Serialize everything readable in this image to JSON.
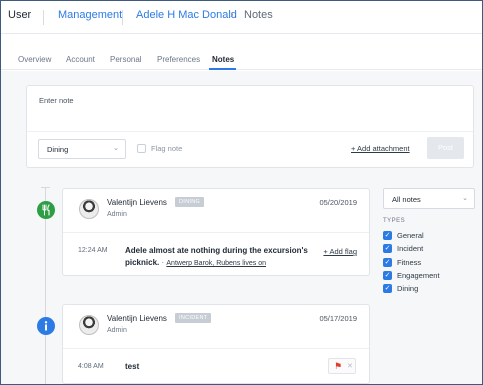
{
  "header": {
    "section": "User",
    "breadcrumb": [
      "Management",
      "Adele H Mac Donald",
      "Notes"
    ],
    "chevron": "›"
  },
  "tabs": [
    {
      "label": "Overview",
      "active": false
    },
    {
      "label": "Account",
      "active": false
    },
    {
      "label": "Personal",
      "active": false
    },
    {
      "label": "Preferences",
      "active": false
    },
    {
      "label": "Notes",
      "active": true
    }
  ],
  "composer": {
    "placeholder": "Enter note",
    "category": "Dining",
    "flag_label": "Flag note",
    "add_attachment": "+ Add attachment",
    "post_label": "Post"
  },
  "notes": [
    {
      "icon": "fork-knife-icon",
      "icon_color": "#2e9e45",
      "author": "Valentijn Lievens",
      "badge": "DINING",
      "role": "Admin",
      "date": "05/20/2019",
      "time": "12:24 AM",
      "text": "Adele almost ate nothing during the excursion's picknick.",
      "separator": "·",
      "link": "Antwerp Barok, Rubens lives on",
      "action": "+ Add flag"
    },
    {
      "icon": "info-icon",
      "icon_color": "#2c7be5",
      "author": "Valentijn Lievens",
      "badge": "INCIDENT",
      "role": "Admin",
      "date": "05/17/2019",
      "time": "4:08 AM",
      "text": "test",
      "flagged": true,
      "flag_color": "#e23b2e"
    }
  ],
  "filter": {
    "selected": "All notes",
    "types_heading": "TYPES",
    "types": [
      {
        "label": "General",
        "checked": true
      },
      {
        "label": "Incident",
        "checked": true
      },
      {
        "label": "Fitness",
        "checked": true
      },
      {
        "label": "Engagement",
        "checked": true
      },
      {
        "label": "Dining",
        "checked": true
      }
    ]
  },
  "colors": {
    "accent": "#2c7be5",
    "dining": "#2e9e45",
    "flag": "#e23b2e"
  }
}
